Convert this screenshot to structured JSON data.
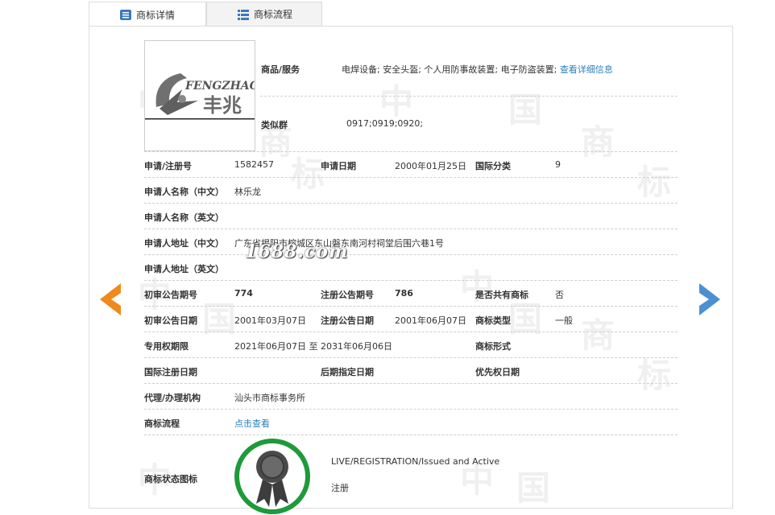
{
  "tabs": [
    {
      "label": "商标详情"
    },
    {
      "label": "商标流程"
    }
  ],
  "logo": {
    "text_en": "FENGZHAO",
    "text_cn": "丰兆"
  },
  "goods": {
    "label": "商品/服务",
    "value": "电焊设备; 安全头盔; 个人用防事故装置; 电子防盗装置;",
    "link": "查看详细信息"
  },
  "similar_group": {
    "label": "类似群",
    "value": "0917;0919;0920;"
  },
  "rows": {
    "reg_no": {
      "label": "申请/注册号",
      "value": "1582457"
    },
    "apply_date": {
      "label": "申请日期",
      "value": "2000年01月25日"
    },
    "intl_class": {
      "label": "国际分类",
      "value": "9"
    },
    "applicant_cn": {
      "label": "申请人名称（中文）",
      "value": "林乐龙"
    },
    "applicant_en": {
      "label": "申请人名称（英文）",
      "value": ""
    },
    "address_cn": {
      "label": "申请人地址（中文）",
      "value": "广东省揭阳市榕城区东山磐东南河村祠堂后围六巷1号"
    },
    "address_en": {
      "label": "申请人地址（英文）",
      "value": ""
    },
    "prelim_no": {
      "label": "初审公告期号",
      "value": "774"
    },
    "reg_pub_no": {
      "label": "注册公告期号",
      "value": "786"
    },
    "shared": {
      "label": "是否共有商标",
      "value": "否"
    },
    "prelim_date": {
      "label": "初审公告日期",
      "value": "2001年03月07日"
    },
    "reg_pub_date": {
      "label": "注册公告日期",
      "value": "2001年06月07日"
    },
    "tm_type": {
      "label": "商标类型",
      "value": "一般"
    },
    "exclusive": {
      "label": "专用权期限",
      "value": "2021年06月07日 至 2031年06月06日"
    },
    "tm_form": {
      "label": "商标形式",
      "value": ""
    },
    "intl_reg_date": {
      "label": "国际注册日期",
      "value": ""
    },
    "later_date": {
      "label": "后期指定日期",
      "value": ""
    },
    "priority_date": {
      "label": "优先权日期",
      "value": ""
    },
    "agent": {
      "label": "代理/办理机构",
      "value": "汕头市商标事务所"
    },
    "process": {
      "label": "商标流程",
      "value": "点击查看"
    },
    "status": {
      "label": "商标状态图标",
      "en": "LIVE/REGISTRATION/Issued and Active",
      "cn": "注册"
    }
  },
  "watermark": {
    "site": "1688.com",
    "chars": [
      "中",
      "国",
      "商",
      "标"
    ]
  },
  "colors": {
    "prev_arrow": "#f08a1c",
    "next_arrow": "#4a90d2",
    "seal_ring": "#1e9a3a",
    "link": "#2a80b9"
  },
  "icons": {
    "prev": "chevron-left-icon",
    "next": "chevron-right-icon",
    "tab1": "list-detail-icon",
    "tab2": "table-list-icon"
  }
}
